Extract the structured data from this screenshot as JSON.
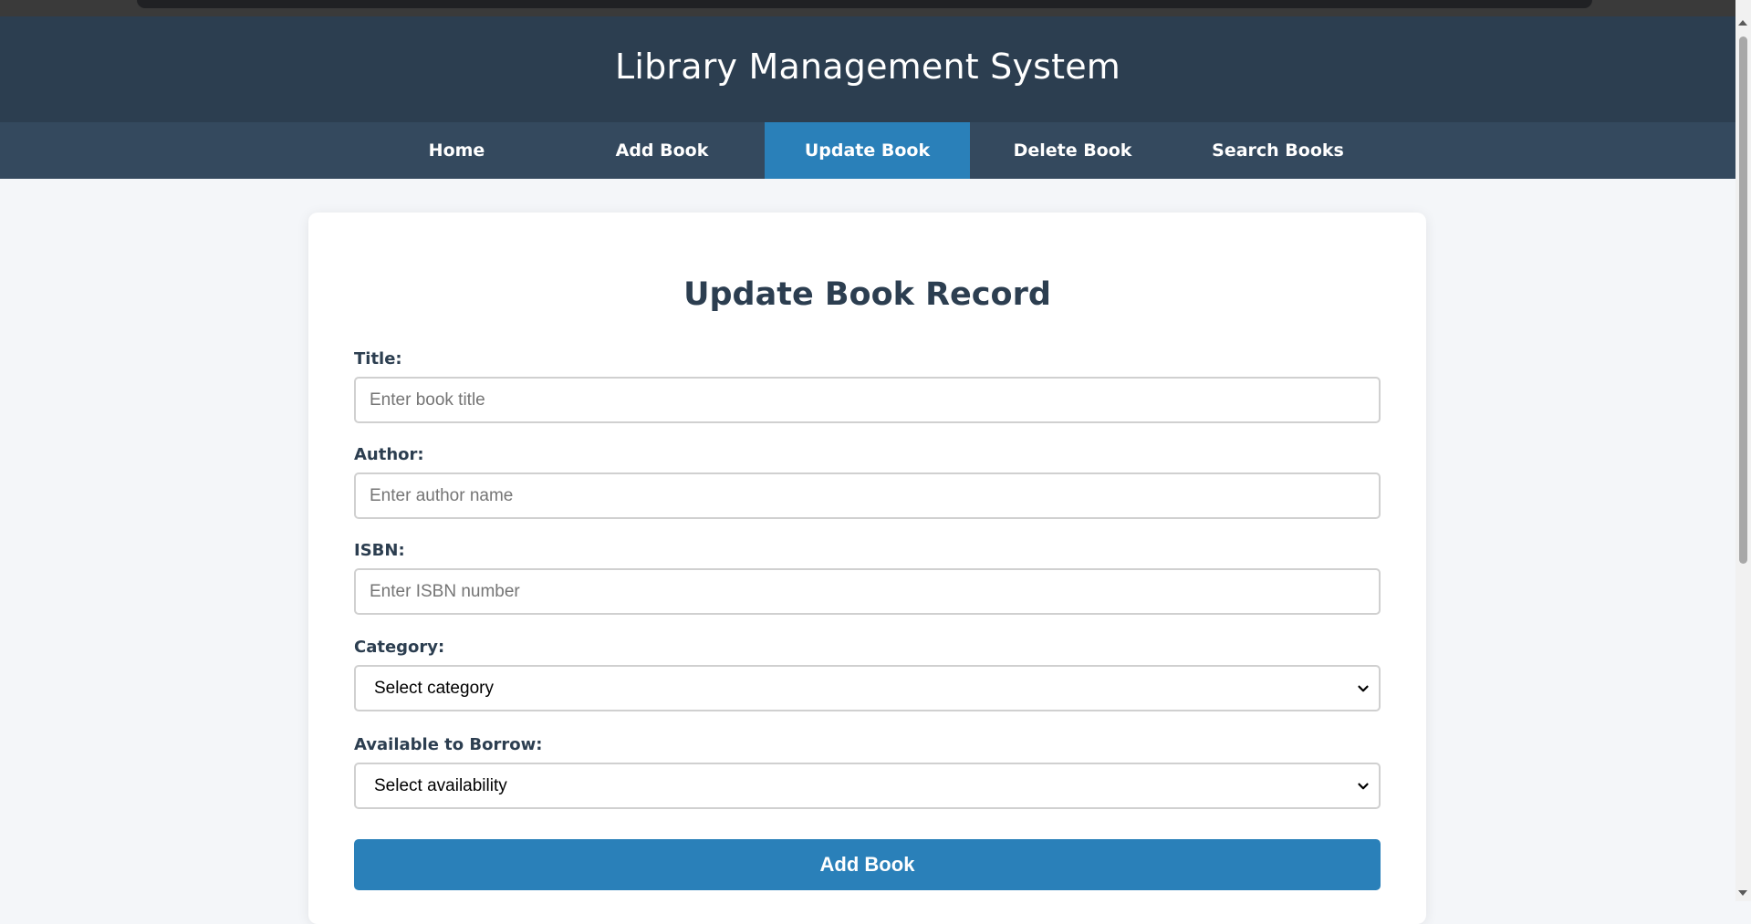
{
  "header": {
    "title": "Library Management System"
  },
  "nav": {
    "items": [
      {
        "label": "Home",
        "active": false
      },
      {
        "label": "Add Book",
        "active": false
      },
      {
        "label": "Update Book",
        "active": true
      },
      {
        "label": "Delete Book",
        "active": false
      },
      {
        "label": "Search Books",
        "active": false
      }
    ]
  },
  "form": {
    "heading": "Update Book Record",
    "title": {
      "label": "Title:",
      "placeholder": "Enter book title",
      "value": ""
    },
    "author": {
      "label": "Author:",
      "placeholder": "Enter author name",
      "value": ""
    },
    "isbn": {
      "label": "ISBN:",
      "placeholder": "Enter ISBN number",
      "value": ""
    },
    "category": {
      "label": "Category:",
      "selected": "Select category"
    },
    "availability": {
      "label": "Available to Borrow:",
      "selected": "Select availability"
    },
    "submit_label": "Add Book"
  },
  "colors": {
    "header_bg": "#2c3e50",
    "nav_bg": "#34495e",
    "accent": "#2a80b9",
    "page_bg": "#f4f6f9"
  },
  "icons": {
    "select_arrow": "chevron-down-icon"
  }
}
